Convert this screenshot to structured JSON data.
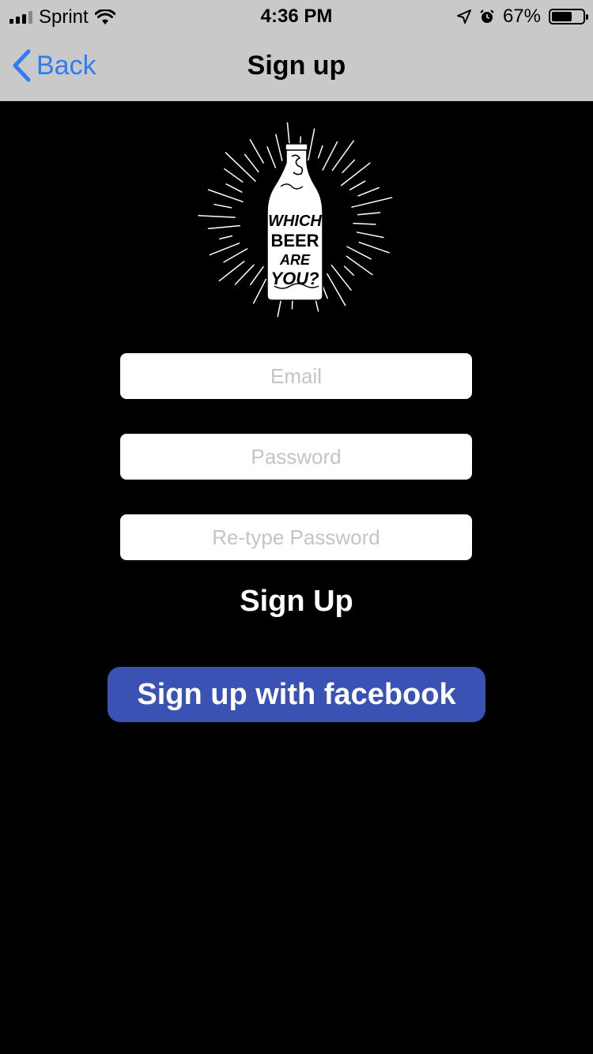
{
  "status_bar": {
    "carrier": "Sprint",
    "time": "4:36 PM",
    "battery_percent": "67%",
    "battery_level": 0.67,
    "icons": [
      "signal-icon",
      "wifi-icon",
      "location-icon",
      "alarm-icon",
      "battery-icon"
    ]
  },
  "nav": {
    "back_label": "Back",
    "title": "Sign up",
    "accent_color": "#2f7cf6"
  },
  "logo": {
    "text_lines": [
      "WHICH",
      "BEER",
      "ARE",
      "YOU?"
    ]
  },
  "form": {
    "email_placeholder": "Email",
    "email_value": "",
    "password_placeholder": "Password",
    "password_value": "",
    "retype_placeholder": "Re-type Password",
    "retype_value": ""
  },
  "actions": {
    "signup_label": "Sign Up",
    "facebook_label": "Sign up with facebook",
    "facebook_color": "#3a52b4"
  }
}
